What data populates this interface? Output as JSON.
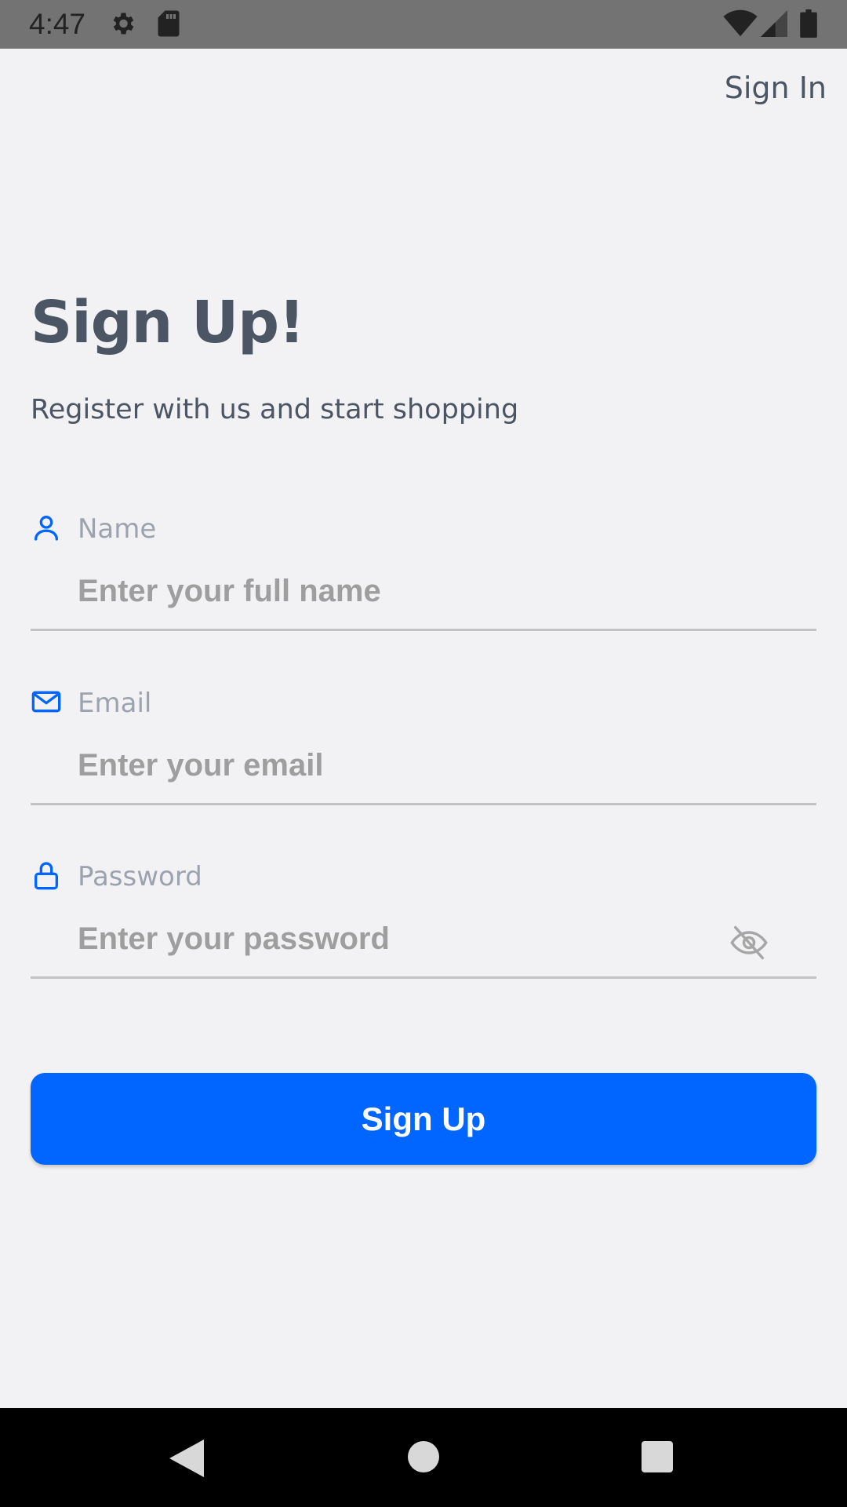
{
  "status_bar": {
    "time": "4:47",
    "icons": [
      "settings-icon",
      "sd-card-icon",
      "wifi-icon",
      "signal-icon",
      "battery-icon"
    ]
  },
  "header": {
    "sign_in_label": "Sign In"
  },
  "main": {
    "title": "Sign Up!",
    "subtitle": "Register with us and start shopping",
    "fields": {
      "name": {
        "label": "Name",
        "placeholder": "Enter your full name",
        "value": "",
        "icon": "person-icon"
      },
      "email": {
        "label": "Email",
        "placeholder": "Enter your email",
        "value": "",
        "icon": "mail-icon"
      },
      "password": {
        "label": "Password",
        "placeholder": "Enter your password",
        "value": "",
        "icon": "lock-icon",
        "toggle_icon": "eye-off-icon"
      }
    },
    "submit_label": "Sign Up"
  },
  "nav_bar": {
    "icons": [
      "back-icon",
      "home-icon",
      "recents-icon"
    ]
  },
  "colors": {
    "accent": "#0066ff",
    "background": "#f2f2f4",
    "text": "#4b5563",
    "placeholder": "#9e9e9e"
  }
}
